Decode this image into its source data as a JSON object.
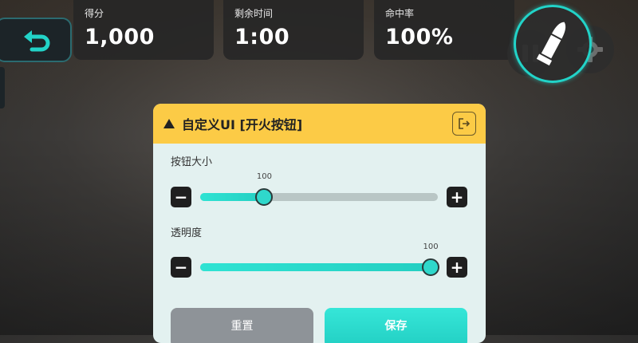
{
  "hud": {
    "score": {
      "label": "得分",
      "value": "1,000"
    },
    "time": {
      "label": "剩余时间",
      "value": "1:00"
    },
    "accuracy": {
      "label": "命中率",
      "value": "100%"
    }
  },
  "panel": {
    "title": "自定义UI [开火按钮]",
    "settings": [
      {
        "label": "按钮大小",
        "value": "100",
        "level": 0.27
      },
      {
        "label": "透明度",
        "value": "100",
        "level": 0.97
      }
    ],
    "reset_label": "重置",
    "save_label": "保存"
  },
  "icons": {
    "back": "back-arrow-icon",
    "fire": "bullet-icon",
    "pause": "pause-icon",
    "settings": "gear-icon",
    "exit": "exit-icon",
    "header": "warning-icon"
  },
  "colors": {
    "accent": "#22d3c8",
    "header": "#fccb46",
    "panel": "#e3f1f0"
  }
}
